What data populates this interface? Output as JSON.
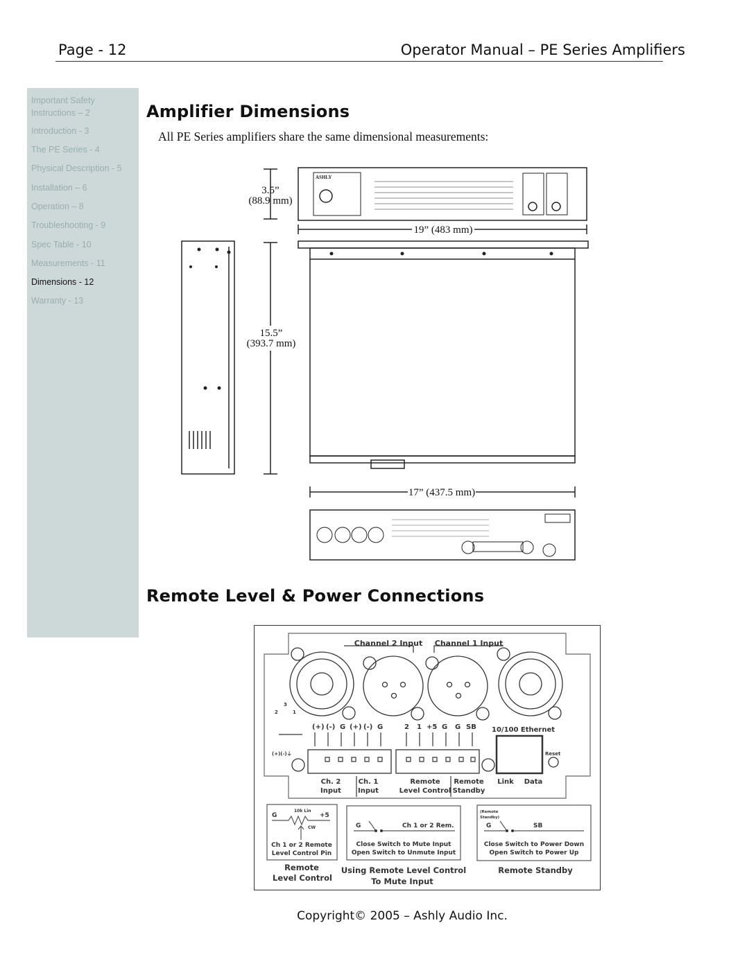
{
  "header": {
    "page": "Page - 12",
    "title": "Operator Manual – PE Series Amplifiers"
  },
  "sidebar": {
    "items": [
      {
        "label": "Important Safety Instructions – 2",
        "line1": "Important Safety",
        "line2": "Instructions – 2",
        "active": false
      },
      {
        "label": "Introduction - 3",
        "active": false
      },
      {
        "label": "The PE Series - 4",
        "active": false
      },
      {
        "label": "Physical Description - 5",
        "active": false
      },
      {
        "label": "Installation – 6",
        "active": false
      },
      {
        "label": "Operation – 8",
        "active": false
      },
      {
        "label": "Troubleshooting - 9",
        "active": false
      },
      {
        "label": "Spec Table - 10",
        "active": false
      },
      {
        "label": "Measurements - 11",
        "active": false
      },
      {
        "label": "Dimensions - 12",
        "active": true
      },
      {
        "label": "Warranty - 13",
        "active": false
      }
    ]
  },
  "section1": {
    "title": "Amplifier Dimensions",
    "intro": "All PE Series amplifiers share the same dimensional measurements:",
    "dims": {
      "height_in": "3.5”",
      "height_mm": "(88.9 mm)",
      "width": "19” (483 mm)",
      "depth_in": "15.5”",
      "depth_mm": "(393.7 mm)",
      "chassis_width": "17” (437.5 mm)"
    },
    "brand": "ASHLY"
  },
  "section2": {
    "title": "Remote Level & Power Connections",
    "panel": {
      "ch2_input": "Channel 2 Input",
      "ch1_input": "Channel 1 Input",
      "pins_left": [
        "(+)",
        "(-)",
        "G",
        "(+)",
        "(-)",
        "G"
      ],
      "pins_right": [
        "2",
        "1",
        "+5",
        "G",
        "G",
        "SB"
      ],
      "ethernet": "10/100 Ethernet",
      "reset": "Reset",
      "jack_pins": [
        "3",
        "2",
        "1"
      ],
      "jack_legend": "(+)(-)⏚",
      "labels": {
        "ch2": "Ch. 2",
        "ch2b": "Input",
        "ch1": "Ch. 1",
        "ch1b": "Input",
        "rlc": "Remote",
        "rlcb": "Level Control",
        "rs": "Remote",
        "rsb": "Standby",
        "link": "Link",
        "data": "Data"
      }
    },
    "box1": {
      "g": "G",
      "pot": "10k Lin",
      "plus": "+5",
      "cw": "CW",
      "text1": "Ch 1 or 2 Remote",
      "text2": "Level Control Pin",
      "caption1": "Remote",
      "caption2": "Level Control"
    },
    "box2": {
      "g": "G",
      "right": "Ch 1 or 2 Rem.",
      "text1": "Close Switch to Mute Input",
      "text2": "Open Switch to Unmute Input",
      "caption1": "Using Remote Level Control",
      "caption2": "To Mute Input"
    },
    "box3": {
      "note1": "(Remote",
      "note2": "Standby)",
      "g": "G",
      "right": "SB",
      "text1": "Close Switch to Power Down",
      "text2": "Open Switch to Power Up",
      "caption": "Remote Standby"
    }
  },
  "footer": {
    "copyright": "Copyright© 2005 – Ashly Audio Inc."
  }
}
